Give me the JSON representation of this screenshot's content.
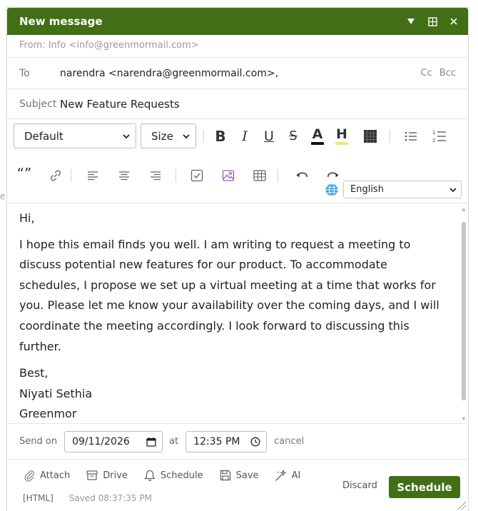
{
  "window": {
    "title": "New message",
    "accent_color": "#426e16",
    "controls": [
      "minimize-icon",
      "maximize-icon",
      "close-icon"
    ]
  },
  "from": {
    "text": "From: Info <info@greenmormail.com>"
  },
  "to": {
    "label": "To",
    "value": "narendra <narendra@greenmormail.com>,",
    "cc": "Cc",
    "bcc": "Bcc"
  },
  "subject": {
    "label": "Subject",
    "value": "New Feature Requests"
  },
  "toolbar": {
    "font_select": "Default",
    "size_select": "Size",
    "bold": "B",
    "italic": "I",
    "underline": "U",
    "strike": "S",
    "font_color": "A",
    "highlight": "H",
    "quote": "“”",
    "language": "English"
  },
  "body": {
    "greeting": "Hi,",
    "paragraph": "I hope this email finds you well. I am writing to request a meeting to discuss potential new features for our product. To accommodate schedules, I propose we set up a virtual meeting at a time that works for you. Please let me know your availability over the coming days, and I will coordinate the meeting accordingly. I look forward to discussing this further.",
    "signoff": "Best,",
    "name": "Niyati Sethia",
    "company": "Greenmor"
  },
  "send_on": {
    "label": "Send on",
    "date": "09/11/2026",
    "at": "at",
    "time": "12:35 PM",
    "cancel": "cancel"
  },
  "footer": {
    "attach": "Attach",
    "drive": "Drive",
    "schedule": "Schedule",
    "save": "Save",
    "ai": "AI",
    "html": "[HTML]",
    "saved": "Saved 08:37:35 PM",
    "discard": "Discard",
    "schedule_button": "Schedule"
  },
  "edge_fragment": "e"
}
